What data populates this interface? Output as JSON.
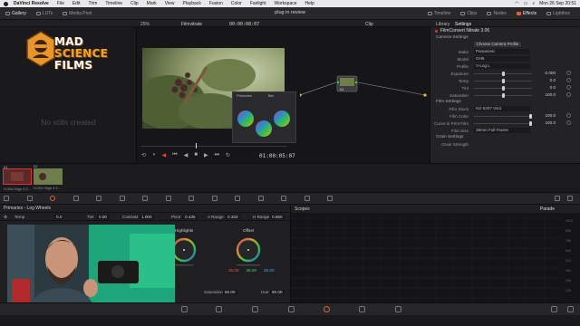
{
  "menubar": {
    "app": "DaVinci Resolve",
    "menus": [
      "File",
      "Edit",
      "Trim",
      "Timeline",
      "Clip",
      "Mark",
      "View",
      "Playback",
      "Fusion",
      "Color",
      "Fairlight",
      "Workspace",
      "Help"
    ],
    "clock": "Mon 26 Sep 20:51"
  },
  "toolbar": {
    "left_tabs": [
      "Gallery",
      "LUTs",
      "Media Pool"
    ],
    "project_title": "plug in review",
    "right_tabs": [
      "Timeline",
      "Clips",
      "Nodes",
      "Effects",
      "Lightbox"
    ],
    "active_right": "Effects"
  },
  "viewer_bar": {
    "zoom": "25%",
    "clip_name": "Filmvitrate",
    "source_tc": "00:00:08:07",
    "mode": "Clip",
    "lib_tab": "Library",
    "settings_tab": "Settings"
  },
  "gallery": {
    "empty_text": "No stills created",
    "logo_line1": "MAD",
    "logo_line2": "SCIENCE",
    "logo_line3": "FILMS"
  },
  "viewer": {
    "timecode": "01:00:05:07"
  },
  "float_panel": {
    "tab1": "Primaries",
    "tab2": "Bar"
  },
  "node": {
    "label": "01"
  },
  "settings_panel": {
    "plugin_name": "FilmConvert Nitrate 3.06",
    "camera_section": "Camera Settings",
    "choose_profile": "Choose Camera Profile",
    "camera_rows": [
      {
        "label": "Make",
        "value": "Panasonic"
      },
      {
        "label": "Model",
        "value": "GH5"
      },
      {
        "label": "Profile",
        "value": "V-Log L"
      }
    ],
    "sliders": [
      {
        "label": "Exposure",
        "value": "0.000",
        "pos": 0.5
      },
      {
        "label": "Temp",
        "value": "0.0",
        "pos": 0.5
      },
      {
        "label": "Tint",
        "value": "0.0",
        "pos": 0.5
      },
      {
        "label": "Saturation",
        "value": "100.0",
        "pos": 0.5
      }
    ],
    "film_section": "Film Settings",
    "film_rows": [
      {
        "label": "Film Stock",
        "value": "KD 5207 Vis3"
      }
    ],
    "film_sliders": [
      {
        "label": "Film Color",
        "value": "100.0",
        "pos": 1.0
      },
      {
        "label": "Curve to Print Film",
        "value": "100.0",
        "pos": 1.0
      }
    ],
    "film_size_label": "Film Size",
    "film_size_value": "35mm Full Frame",
    "grain_section": "Grain Settings",
    "grain_label": "Grain Strength"
  },
  "clips": [
    {
      "num": "01",
      "name": "H.264 High 4:2..."
    },
    {
      "num": "02",
      "name": "H.264 High 4:2..."
    }
  ],
  "primaries": {
    "title": "Primaries - Log Wheels",
    "params": [
      {
        "label": "Temp",
        "value": "0.0"
      },
      {
        "label": "Tint",
        "value": "0.00"
      },
      {
        "label": "Contrast",
        "value": "1.000"
      },
      {
        "label": "Pivot",
        "value": "0.435"
      },
      {
        "label": "A Range",
        "value": "0.333"
      },
      {
        "label": "H Range",
        "value": "0.550"
      }
    ],
    "wheel_highlights": "Highlights",
    "wheel_offset": "Offset",
    "offset_values": [
      "25.00",
      "25.00",
      "25.00"
    ],
    "sat_label": "Saturation",
    "sat_value": "50.00",
    "hue_label": "Hue",
    "hue_value": "50.00"
  },
  "scopes": {
    "title": "Scopes",
    "mode": "Parade",
    "scale": [
      "1023",
      "896",
      "768",
      "640",
      "512",
      "384",
      "256",
      "128",
      "0"
    ]
  },
  "colors": {
    "accent": "#e0622a",
    "panel": "#232326",
    "bg": "#1c1c1e"
  }
}
